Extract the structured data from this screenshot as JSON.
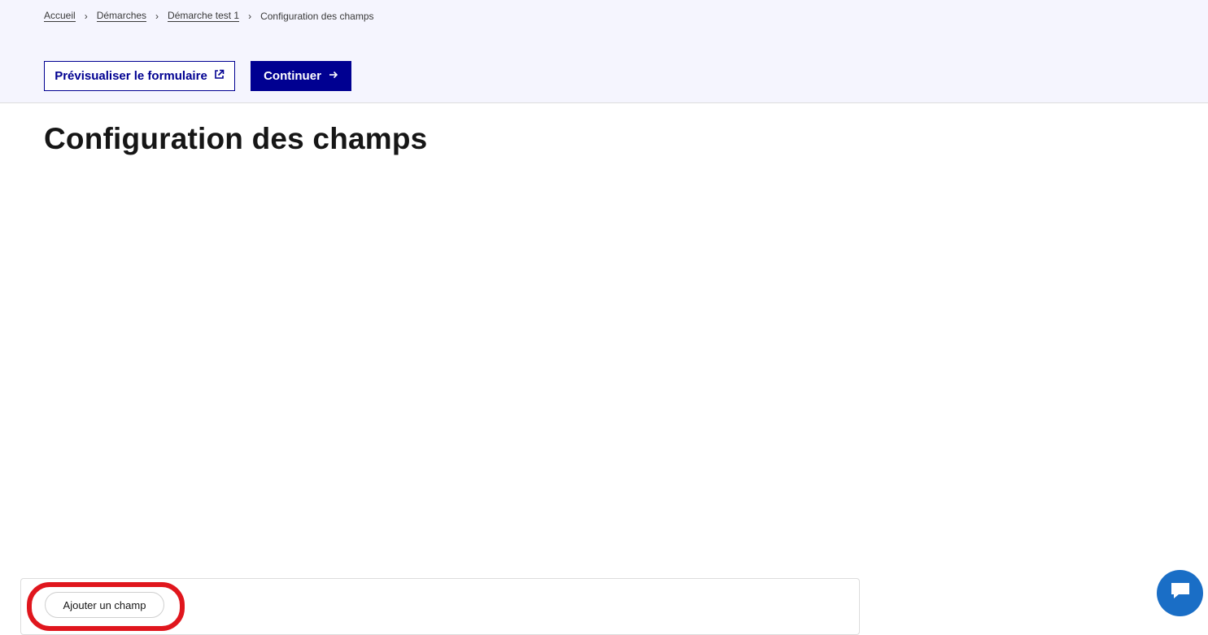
{
  "breadcrumb": {
    "items": [
      "Accueil",
      "Démarches",
      "Démarche test 1"
    ],
    "current": "Configuration des champs"
  },
  "toolbar": {
    "preview_label": "Prévisualiser le formulaire",
    "continue_label": "Continuer"
  },
  "page": {
    "title": "Configuration des champs"
  },
  "editor": {
    "add_field_label": "Ajouter un champ"
  },
  "icons": {
    "external_link": "external-link-icon",
    "arrow_right": "arrow-right-icon",
    "chevron_right": "chevron-right-icon",
    "chat": "chat-icon"
  },
  "colors": {
    "brand_primary": "#000091",
    "header_background": "#f5f5fe",
    "highlight": "#e0161d",
    "chat": "#1a6ec6"
  }
}
